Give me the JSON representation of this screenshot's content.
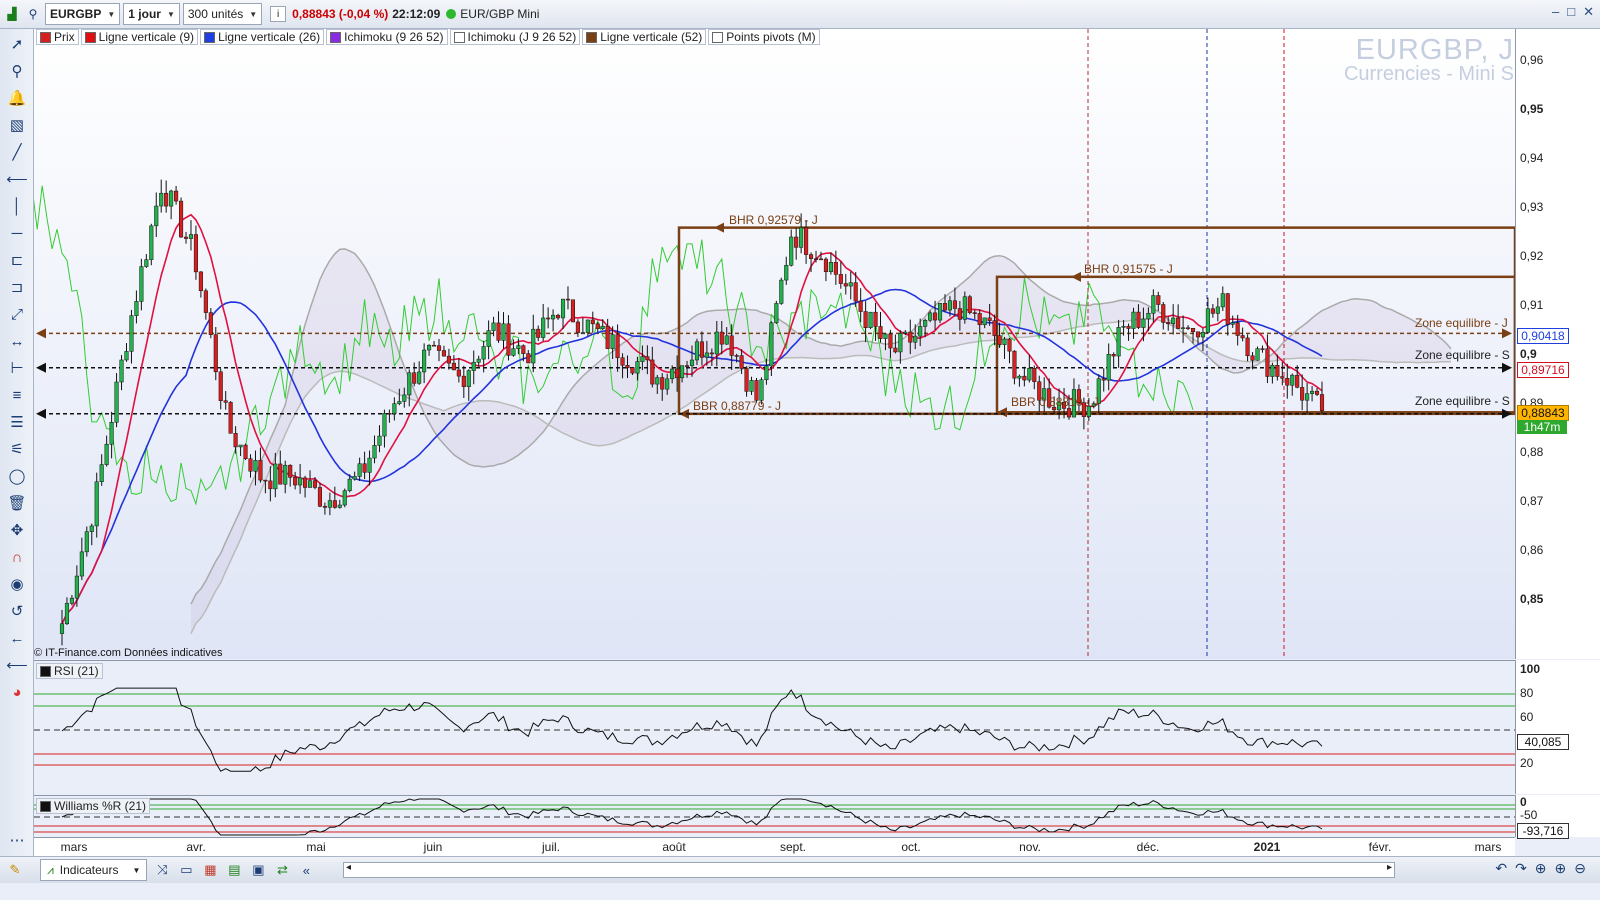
{
  "toolbar": {
    "symbol": "EURGBP",
    "period": "1 jour",
    "units": "300 unités",
    "price_change": "0,88843 (-0,04 %)",
    "time": "22:12:09",
    "instrument": "EUR/GBP Mini",
    "window_controls": [
      "–",
      "□",
      "✕"
    ]
  },
  "legend": [
    {
      "label": "Prix",
      "color": "#d62020"
    },
    {
      "label": "Ligne verticale (9)",
      "color": "#e01010"
    },
    {
      "label": "Ligne verticale (26)",
      "color": "#1f3fe0"
    },
    {
      "label": "Ichimoku (9 26 52)",
      "color": "#8a2be2"
    },
    {
      "label": "Ichimoku (J 9 26 52)",
      "color": "#ffffff"
    },
    {
      "label": "Ligne verticale (52)",
      "color": "#7a3f14"
    },
    {
      "label": "Points pivots (M)",
      "color": "#ffffff"
    }
  ],
  "watermark": {
    "line1": "EURGBP, J",
    "line2": "Currencies - Mini S"
  },
  "copyright": "© IT-Finance.com Données indicatives",
  "price_axis": {
    "ticks": [
      "0,96",
      "0,95",
      "0,94",
      "0,93",
      "0,92",
      "0,91",
      "0,9",
      "0,89",
      "0,88",
      "0,87",
      "0,86",
      "0,85"
    ]
  },
  "price_tags": {
    "upper": "0,90418",
    "mid": "0,89716",
    "last": "0,88843",
    "countdown": "1h47m"
  },
  "levels": {
    "bhr1": "BHR 0,92579 - J",
    "bhr2": "BHR 0,91575 - J",
    "bbr1": "BBR 0,88779 - J",
    "bbr2": "BBR 0,88810 - J",
    "zone1": "Zone equilibre - J",
    "zone2": "Zone equilibre - S",
    "zone3": "Zone equilibre - S"
  },
  "rsi": {
    "label": "RSI (21)",
    "ticks": [
      "100",
      "80",
      "60",
      "40",
      "20"
    ],
    "value": "40,085"
  },
  "williams": {
    "label": "Williams %R (21)",
    "ticks": [
      "0",
      "-50"
    ],
    "value": "-93,716"
  },
  "time_axis": [
    "mars",
    "avr.",
    "mai",
    "juin",
    "juil.",
    "août",
    "sept.",
    "oct.",
    "nov.",
    "déc.",
    "2021",
    "févr.",
    "mars"
  ],
  "bottombar": {
    "indicators_label": "Indicateurs"
  },
  "chart_data": {
    "type": "candlestick",
    "instrument": "EURGBP",
    "timeframe": "1 jour",
    "ylim": [
      0.84,
      0.965
    ],
    "x_range": [
      "mars",
      "mars"
    ],
    "close_approx": [
      0.845,
      0.87,
      0.905,
      0.935,
      0.92,
      0.885,
      0.875,
      0.875,
      0.87,
      0.875,
      0.89,
      0.9,
      0.895,
      0.905,
      0.9,
      0.91,
      0.905,
      0.9,
      0.895,
      0.9,
      0.905,
      0.89,
      0.925,
      0.92,
      0.91,
      0.9,
      0.905,
      0.91,
      0.905,
      0.895,
      0.89,
      0.89,
      0.905,
      0.91,
      0.905,
      0.91,
      0.9,
      0.895,
      0.888
    ],
    "last": 0.88843,
    "horizontal_levels": [
      {
        "name": "BHR 0,92579 - J",
        "value": 0.92579
      },
      {
        "name": "BHR 0,91575 - J",
        "value": 0.91575
      },
      {
        "name": "BBR 0,88779 - J",
        "value": 0.88779
      },
      {
        "name": "BBR 0,88810 - J",
        "value": 0.8881
      },
      {
        "name": "Zone equilibre - J",
        "value": 0.9042
      },
      {
        "name": "Zone equilibre - S",
        "value": 0.8972
      },
      {
        "name": "Zone equilibre - S",
        "value": 0.8878
      }
    ],
    "indicators": [
      "RSI (21)",
      "Williams %R (21)",
      "Ichimoku (9 26 52)",
      "Points pivots (M)"
    ]
  }
}
